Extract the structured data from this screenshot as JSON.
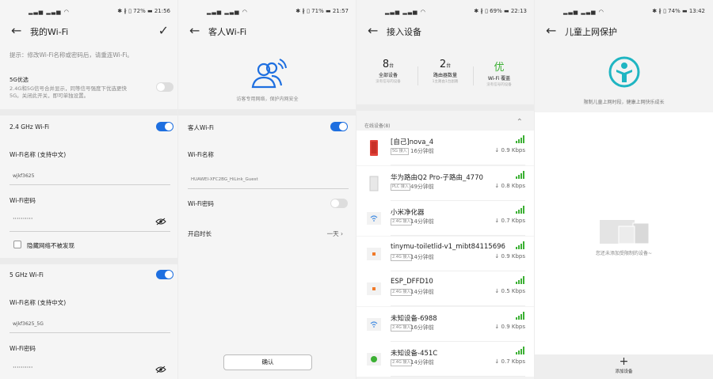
{
  "colors": {
    "accent": "#1E6FE0",
    "green": "#3CB034",
    "cyan": "#1FB5C2"
  },
  "p1": {
    "status": {
      "time": "21:56",
      "battery": "72%"
    },
    "title": "我的Wi-Fi",
    "hint": "提示：修改Wi-Fi名称或密码后，请重连Wi-Fi。",
    "g5pref_title": "5G优选",
    "g5pref_desc1": "2.4G和5G信号合并显示，同等信号强度下优选更快",
    "g5pref_desc2": "5G。关闭此开关，即可单独设置。",
    "w24_label": "2.4 GHz Wi-Fi",
    "name_label": "Wi-Fi名称 (支持中文)",
    "name_val": "wjkf3625",
    "pwd_label": "Wi-Fi密码",
    "pwd_val": "··········",
    "hide_label": "隐藏网络不被发现",
    "w5_label": "5 GHz Wi-Fi",
    "name5_label": "Wi-Fi名称 (支持中文)",
    "name5_val": "wjkf3625_5G",
    "pwd5_label": "Wi-Fi密码",
    "pwd5_val": "··········"
  },
  "p2": {
    "status": {
      "time": "21:57",
      "battery": "71%"
    },
    "title": "客人Wi-Fi",
    "desc": "访客专用网络，保护内网安全",
    "guest_label": "客人Wi-Fi",
    "name_label": "Wi-Fi名称",
    "name_val": "HUAWEI-XFC2BG_HiLink_Guest",
    "pwd_label": "Wi-Fi密码",
    "duration_label": "开启时长",
    "duration_val": "一天",
    "confirm": "确认"
  },
  "p3": {
    "status": {
      "time": "22:13",
      "battery": "69%"
    },
    "title": "接入设备",
    "stats": [
      {
        "v": "8",
        "u": "台",
        "l": "全部设备",
        "s": "没有信号的设备"
      },
      {
        "v": "2",
        "u": "台",
        "l": "路由器数量",
        "s": "1主路由1台副路"
      },
      {
        "v": "优",
        "u": "",
        "l": "Wi-Fi 覆盖",
        "s": "没有信号的设备"
      }
    ],
    "online": "在线设备(8)",
    "devices": [
      {
        "name": "[自己]nova_4",
        "tag": "5G 接入",
        "time": "16分钟前",
        "speed": "0.9 Kbps"
      },
      {
        "name": "华为路由Q2 Pro-子路由_4770",
        "tag": "PLC 接入",
        "time": "49分钟前",
        "speed": "0.8 Kbps"
      },
      {
        "name": "小米净化器",
        "tag": "2.4G 接入",
        "time": "14分钟前",
        "speed": "0.7 Kbps"
      },
      {
        "name": "tinymu-toiletlid-v1_mibt84115696",
        "tag": "2.4G 接入",
        "time": "14分钟前",
        "speed": "0.9 Kbps"
      },
      {
        "name": "ESP_DFFD10",
        "tag": "2.4G 接入",
        "time": "14分钟前",
        "speed": "0.5 Kbps"
      },
      {
        "name": "未知设备-6988",
        "tag": "2.4G 接入",
        "time": "16分钟前",
        "speed": "0.9 Kbps"
      },
      {
        "name": "未知设备-451C",
        "tag": "2.4G 接入",
        "time": "14分钟前",
        "speed": "0.7 Kbps"
      }
    ]
  },
  "p4": {
    "status": {
      "time": "13:42",
      "battery": "74%"
    },
    "title": "儿童上网保护",
    "desc": "限制儿童上网时段，健康上网快乐成长",
    "empty": "您还未添加受限制的设备~",
    "add_label": "添加设备"
  }
}
